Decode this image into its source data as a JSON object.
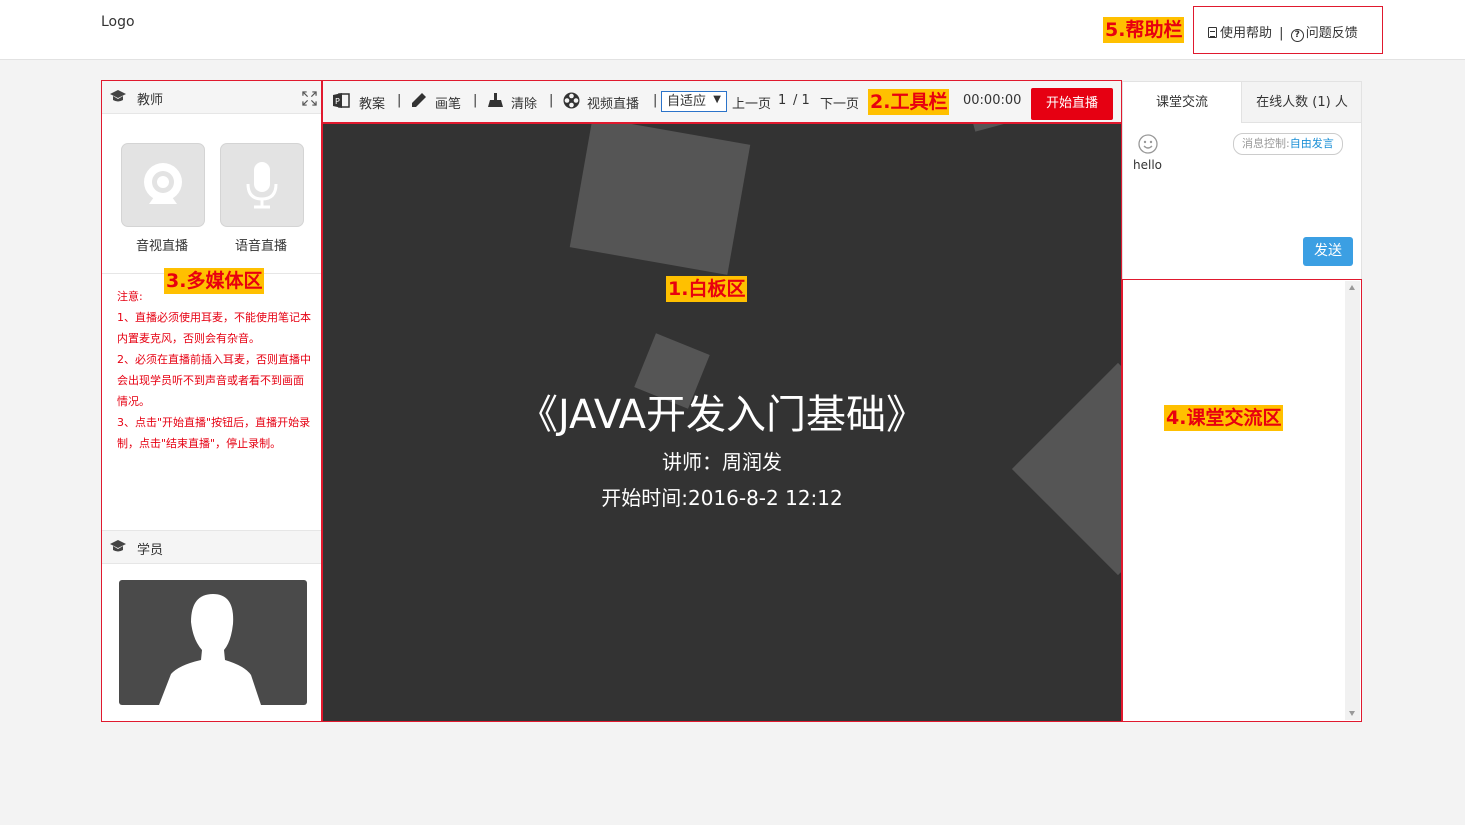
{
  "header": {
    "logo": "Logo",
    "help_label": "使用帮助",
    "separator": "|",
    "feedback_label": "问题反馈"
  },
  "annotations": {
    "whiteboard": "1.白板区",
    "toolbar": "2.工具栏",
    "multimedia": "3.多媒体区",
    "chat": "4.课堂交流区",
    "help": "5.帮助栏"
  },
  "teacher_panel": {
    "title": "教师",
    "video_live": "音视直播",
    "audio_live": "语音直播",
    "notes": [
      "注意:",
      "1、直播必须使用耳麦，不能使用笔记本内置麦克风，否则会有杂音。",
      "2、必须在直播前插入耳麦，否则直播中会出现学员听不到声音或者看不到画面情况。",
      "3、点击\"开始直播\"按钮后，直播开始录制，点击\"结束直播\"，停止录制。"
    ]
  },
  "student_panel": {
    "title": "学员"
  },
  "toolbar": {
    "lesson_plan": "教案",
    "pen": "画笔",
    "clear": "清除",
    "video_live": "视频直播",
    "sep": "|",
    "fit_select": "自适应",
    "prev_page": "上一页",
    "current_page": "1",
    "total_pages": "/ 1",
    "next_page": "下一页",
    "timer": "00:00:00",
    "start_live": "开始直播"
  },
  "whiteboard": {
    "slide_title": "《JAVA开发入门基础》",
    "lecturer": "讲师：周润发",
    "start_time": "开始时间:2016-8-2 12:12"
  },
  "chat": {
    "tab_class_chat": "课堂交流",
    "tab_online": "在线人数 (1) 人",
    "message_text": "hello",
    "msg_control_label": "消息控制:",
    "msg_control_value": "自由发言",
    "send": "发送"
  },
  "colors": {
    "accent_red": "#e60012",
    "tag_bg": "#ffc000",
    "send_blue": "#3b9fe3",
    "board_bg": "#333333"
  }
}
